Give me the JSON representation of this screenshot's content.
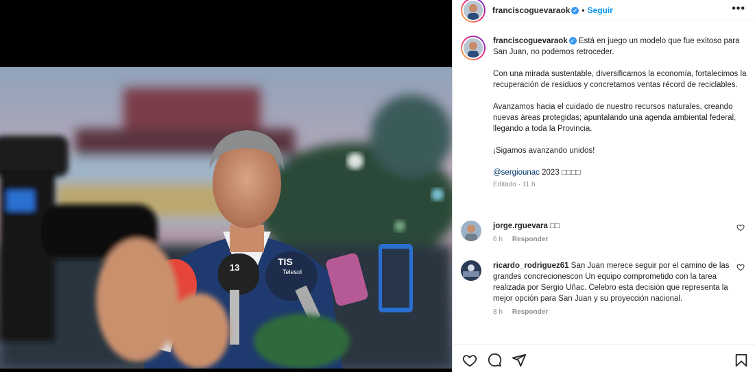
{
  "post": {
    "username": "franciscoguevaraok",
    "verified_mark": "✓",
    "follow_label": "Seguir",
    "dot": "•",
    "more_label": "•••"
  },
  "caption": {
    "username": "franciscoguevaraok",
    "paragraphs": [
      "Está en juego un modelo que fue exitoso para San Juan, no podemos retroceder.",
      "Con una mirada sustentable, diversificamos la economía, fortalecimos la recuperación de residuos y concretamos ventas récord de reciclables.",
      "Avanzamos hacia el cuidado de nuestro recursos naturales, creando nuevas áreas protegidas; apuntalando una agenda ambiental federal, llegando a toda la Provincia.",
      "¡Sigamos avanzando unidos!"
    ],
    "mention": "@sergiounac",
    "tag_suffix": " 2023 ",
    "emoji_boxes": "□□□□",
    "edited": "Editado · 11 h"
  },
  "comments": [
    {
      "username": "jorge.rguevara",
      "text": " □□",
      "time": "6 h",
      "reply_label": "Responder"
    },
    {
      "username": "ricardo_rodriguez61",
      "text": " San Juan merece seguir por el camino de las grandes concrecionescon Un equipo comprometido con la tarea realizada por Sergio Uñac. Celebro esta decisión que representa la mejor opción para San Juan y su proyección nacional.",
      "time": "8 h",
      "reply_label": "Responder"
    }
  ],
  "photo": {
    "mic_labels": [
      "13",
      "TIS",
      "Telesol"
    ]
  },
  "icons": {
    "like": "heart-icon",
    "comment": "comment-icon",
    "share": "share-icon",
    "save": "bookmark-icon",
    "more": "more-options-icon"
  },
  "colors": {
    "accent": "#0095f6",
    "verified": "#3897f0",
    "muted": "#8e8e8e"
  }
}
